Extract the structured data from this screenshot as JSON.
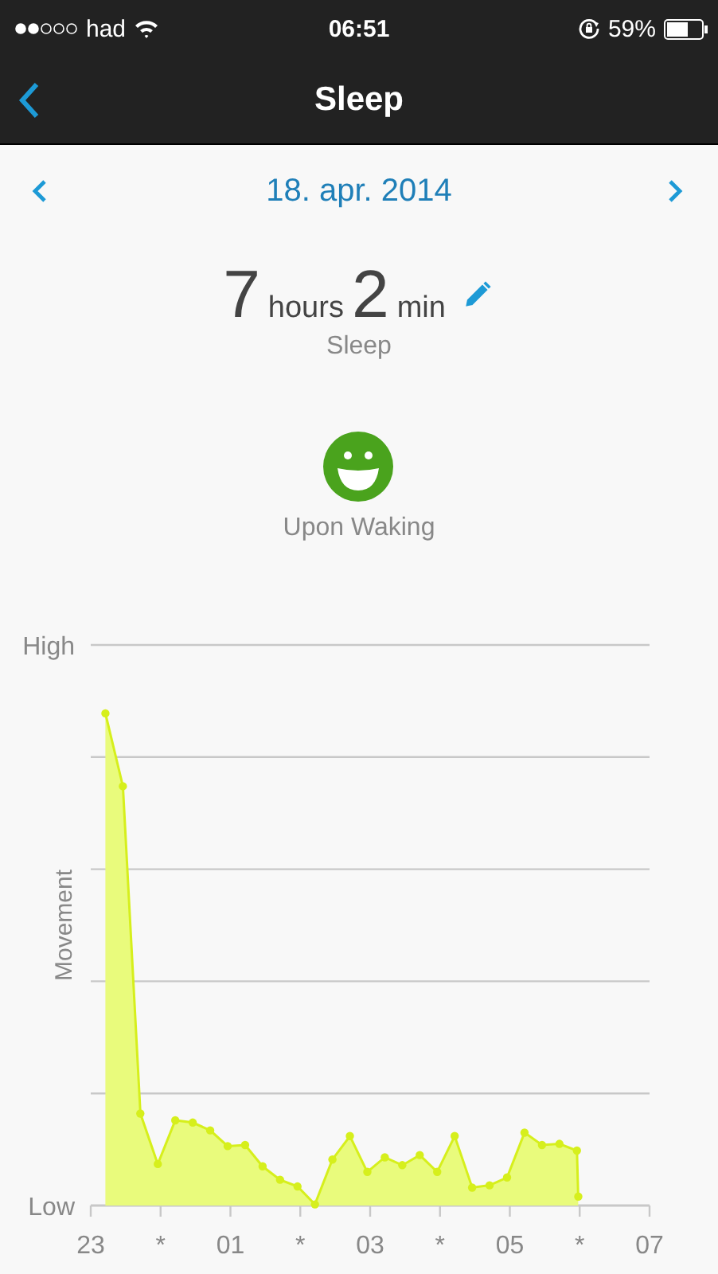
{
  "status_bar": {
    "carrier": "had",
    "time": "06:51",
    "battery": "59%"
  },
  "nav": {
    "title": "Sleep"
  },
  "date_nav": {
    "date": "18. apr. 2014"
  },
  "summary": {
    "hours": "7",
    "hours_unit": "hours",
    "minutes": "2",
    "minutes_unit": "min",
    "label": "Sleep"
  },
  "mood": {
    "kind": "happy",
    "label": "Upon Waking"
  },
  "chart": {
    "high_label": "High",
    "low_label": "Low",
    "axis_label": "Movement",
    "time_labels": [
      "23",
      "*",
      "01",
      "*",
      "03",
      "*",
      "05",
      "*",
      "07"
    ]
  }
}
